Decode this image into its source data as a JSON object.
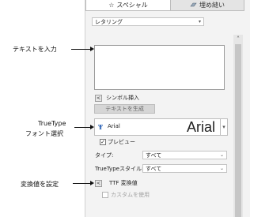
{
  "callouts": {
    "text_input": "テキストを入力",
    "font_select_line1": "TrueType",
    "font_select_line2": "フォント選択",
    "convert_values": "変換値を設定"
  },
  "tabs": [
    {
      "label": "スペシャル",
      "icon": "star-icon",
      "active": true
    },
    {
      "label": "埋め縫い",
      "icon": "fill-stitch-icon",
      "active": false
    }
  ],
  "lettering_select": {
    "value": "レタリング"
  },
  "symbol_insert": {
    "label": "シンボル挿入"
  },
  "generate_button": {
    "label": "テキストを生成"
  },
  "font": {
    "icon": "truetype-icon",
    "name": "Arial",
    "preview_text": "Arial"
  },
  "preview_checkbox": {
    "label": "プレビュー",
    "checked": true
  },
  "type_field": {
    "label": "タイプ:",
    "value": "すべて"
  },
  "truetype_style_field": {
    "label": "TrueTypeスタイル:",
    "value": "すべて"
  },
  "ttf_convert": {
    "label": "TTF 変換値"
  },
  "custom_checkbox": {
    "label": "カスタムを使用",
    "checked": false
  }
}
